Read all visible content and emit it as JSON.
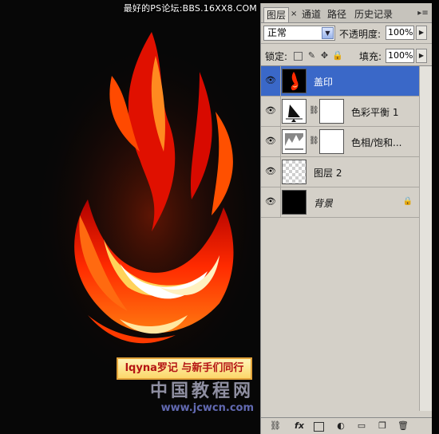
{
  "canvas": {
    "caption": "lqyna罗记 与新手们同行",
    "watermark_top": "最好的PS论坛:BBS.16XX8.COM",
    "watermark_bottom_cn": "中国教程网",
    "watermark_bottom_url": "www.jcwcn.com",
    "flame_colors": [
      "#ff1800",
      "#ff6a00",
      "#ffd35a",
      "#ffffff"
    ]
  },
  "panel": {
    "tabs": [
      {
        "label": "图层",
        "active": true
      },
      {
        "label": "×",
        "active": false
      },
      {
        "label": "通道",
        "active": false
      },
      {
        "label": "路径",
        "active": false
      },
      {
        "label": "历史记录",
        "active": false
      }
    ],
    "menu_icon": "panel-menu-icon",
    "blend_mode": "正常",
    "opacity_label": "不透明度:",
    "opacity_value": "100%",
    "lock_label": "锁定:",
    "fill_label": "填充:",
    "fill_value": "100%",
    "layers": [
      {
        "name": "盖印",
        "selected": true,
        "thumb": "flame"
      },
      {
        "name": "色彩平衡 1",
        "selected": false,
        "thumb": "balance-adjustment",
        "mask": true
      },
      {
        "name": "色相/饱和...",
        "selected": false,
        "thumb": "hue-adjustment",
        "mask": true
      },
      {
        "name": "图层 2",
        "selected": false,
        "thumb": "transparent"
      },
      {
        "name": "背景",
        "selected": false,
        "thumb": "black",
        "locked": true
      }
    ]
  },
  "accent_color": "#3a68c8"
}
